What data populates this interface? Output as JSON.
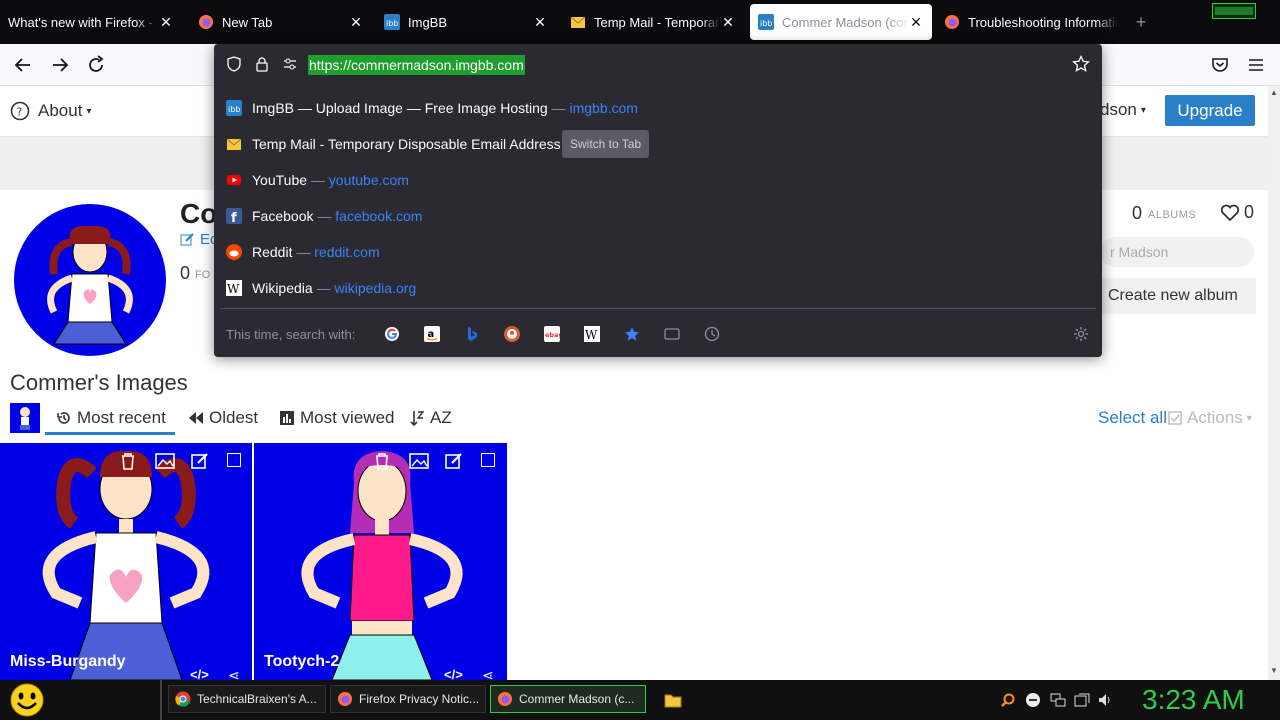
{
  "tabs": [
    {
      "title": "What's new with Firefox - Mozilla",
      "close": "✕"
    },
    {
      "title": "New Tab",
      "close": "✕"
    },
    {
      "title": "ImgBB",
      "close": "✕"
    },
    {
      "title": "Temp Mail - Temporary Disposable",
      "close": "✕"
    },
    {
      "title": "Commer Madson (commermadson)",
      "close": "✕"
    },
    {
      "title": "Troubleshooting Information",
      "close": ""
    }
  ],
  "new_tab": "+",
  "address": {
    "url": "https://commermadson.imgbb.com"
  },
  "suggestions": [
    {
      "title": "ImgBB — Upload Image — Free Image Hosting",
      "dash": "—",
      "url": "imgbb.com",
      "badge": ""
    },
    {
      "title": "Temp Mail - Temporary Disposable Email Address",
      "dash": "",
      "url": "",
      "badge": "Switch to Tab"
    },
    {
      "title": "YouTube",
      "dash": "—",
      "url": "youtube.com",
      "badge": ""
    },
    {
      "title": "Facebook",
      "dash": "—",
      "url": "facebook.com",
      "badge": ""
    },
    {
      "title": "Reddit",
      "dash": "—",
      "url": "reddit.com",
      "badge": ""
    },
    {
      "title": "Wikipedia",
      "dash": "—",
      "url": "wikipedia.org",
      "badge": ""
    }
  ],
  "search_with": "This time, search with:",
  "page": {
    "about": "About",
    "user_menu": "dson",
    "upgrade": "Upgrade",
    "profile_name": "Co",
    "edit": "Ec",
    "followers_count": "0",
    "followers_label": "FO",
    "albums_count": "0",
    "albums_label": "ALBUMS",
    "likes_count": "0",
    "search_placeholder": "r Madson",
    "create_album": "Create new album",
    "images_heading": "Commer's Images",
    "sort": {
      "recent": "Most recent",
      "oldest": "Oldest",
      "viewed": "Most viewed",
      "az": "AZ"
    },
    "select_all": "Select all",
    "actions": "Actions",
    "images": [
      {
        "name": "Miss-Burgandy"
      },
      {
        "name": "Tootych-2"
      }
    ]
  },
  "taskbar": {
    "items": [
      {
        "label": "TechnicalBraixen's A..."
      },
      {
        "label": "Firefox Privacy Notic..."
      },
      {
        "label": "Commer Madson (c..."
      }
    ],
    "clock": "3:23 AM"
  },
  "colors": {
    "upgrade": "#2a80c8",
    "accent_blue": "#2a80c8",
    "image_bg": "#0000e6",
    "url_highlight": "#1e9e2c",
    "clock": "#2fcc4b"
  }
}
